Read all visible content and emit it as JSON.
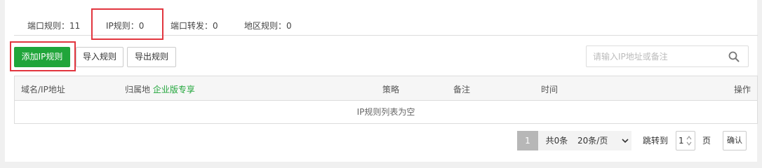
{
  "tabs": {
    "port_rules": "端口规则：11",
    "ip_rules": "IP规则：0",
    "port_forward": "端口转发：0",
    "region_rules": "地区规则：0"
  },
  "toolbar": {
    "add_label": "添加IP规则",
    "import_label": "导入规则",
    "export_label": "导出规则"
  },
  "search": {
    "placeholder": "请输入IP地址或备注",
    "value": ""
  },
  "table": {
    "columns": {
      "domain_ip": "域名/IP地址",
      "location": "归属地",
      "location_promo": "企业版专享",
      "policy": "策略",
      "remark": "备注",
      "time": "时间",
      "actions": "操作"
    },
    "empty_text": "IP规则列表为空"
  },
  "pagination": {
    "current_page": "1",
    "total": "共0条",
    "page_size": "20条/页",
    "jump_label": "跳转到",
    "jump_value": "1",
    "page_unit": "页",
    "confirm_label": "确认"
  },
  "colors": {
    "primary": "#20a53a",
    "highlight_border": "#e2363f"
  }
}
